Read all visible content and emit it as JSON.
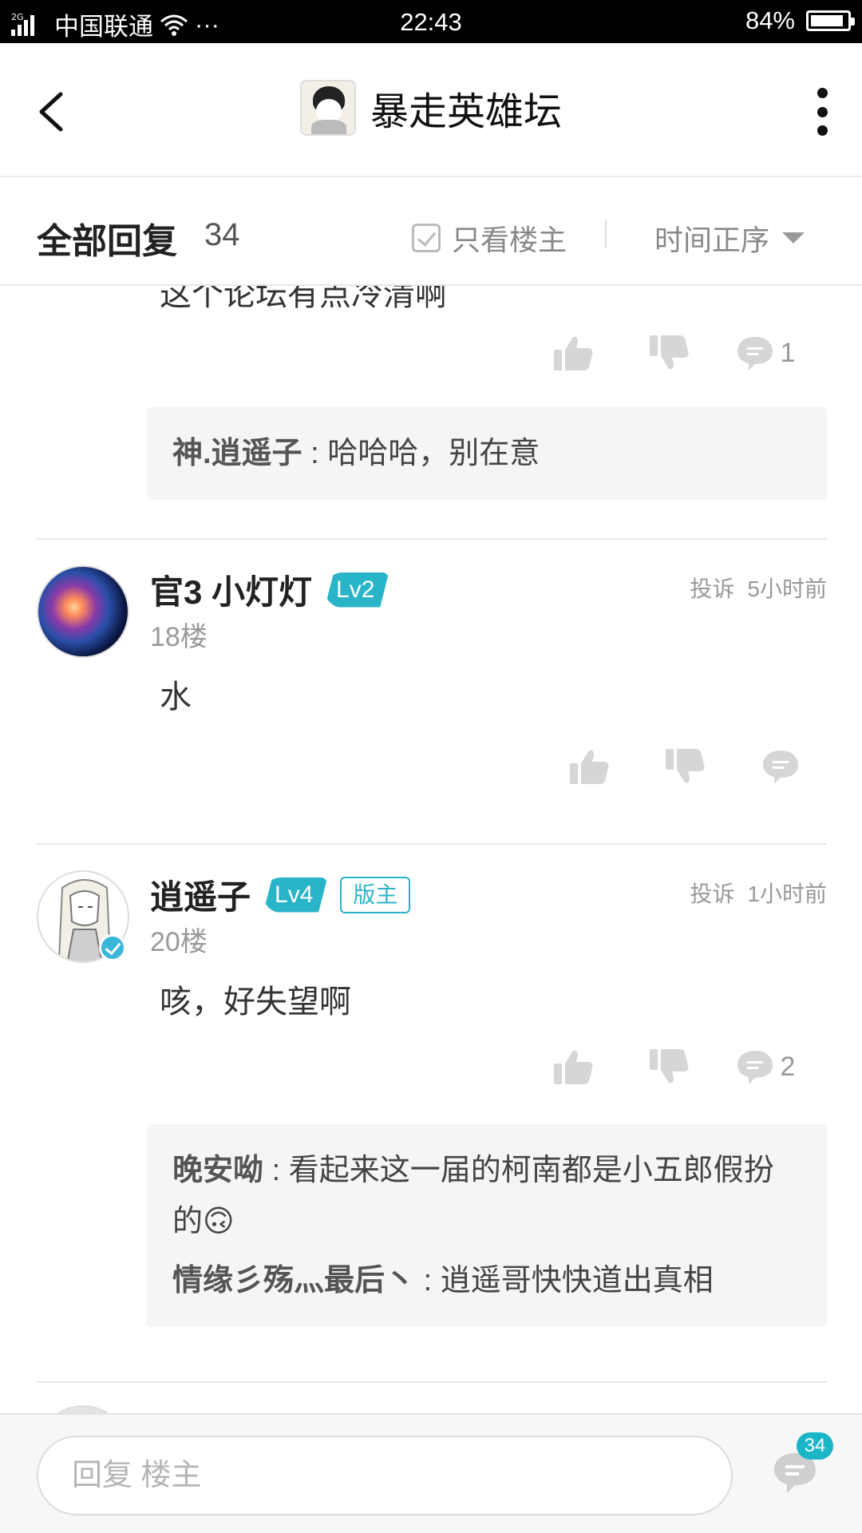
{
  "status_bar": {
    "network": "2G",
    "carrier": "中国联通",
    "dots": "···",
    "time": "22:43",
    "battery": "84%",
    "battery_level": 0.84
  },
  "header": {
    "forum_name": "暴走英雄坛",
    "icons": {
      "back": "back-arrow-icon",
      "more": "more-vertical-icon",
      "logo": "forum-logo"
    }
  },
  "reply_bar": {
    "title": "全部回复",
    "count": "34",
    "only_op_label": "只看楼主",
    "sort_label": "时间正序"
  },
  "posts": [
    {
      "partial_text": "这个论坛有点冷清啊",
      "actions": {
        "like": "",
        "dislike": "",
        "comment_count": "1"
      },
      "sub_replies": [
        {
          "author": "神.逍遥子",
          "sep": " : ",
          "text": "哈哈哈，别在意"
        }
      ]
    },
    {
      "author": "官3 小灯灯",
      "level": "Lv2",
      "report": "投诉",
      "time": "5小时前",
      "floor": "18楼",
      "body": "水",
      "actions": {
        "comment_count": ""
      }
    },
    {
      "author": "逍遥子",
      "level": "Lv4",
      "role_badge": "版主",
      "report": "投诉",
      "time": "1小时前",
      "floor": "20楼",
      "body": "咳，好失望啊",
      "actions": {
        "comment_count": "2"
      },
      "sub_replies": [
        {
          "author": "晚安呦",
          "sep": " : ",
          "text": "看起来这一届的柯南都是小五郎假扮的",
          "emoji": "🙃"
        },
        {
          "author": "情缘彡殇灬最后丶",
          "sep": " : ",
          "text": "逍遥哥快快道出真相"
        }
      ]
    }
  ],
  "bottom_bar": {
    "input_placeholder": "回复  楼主",
    "comment_badge": "34"
  }
}
